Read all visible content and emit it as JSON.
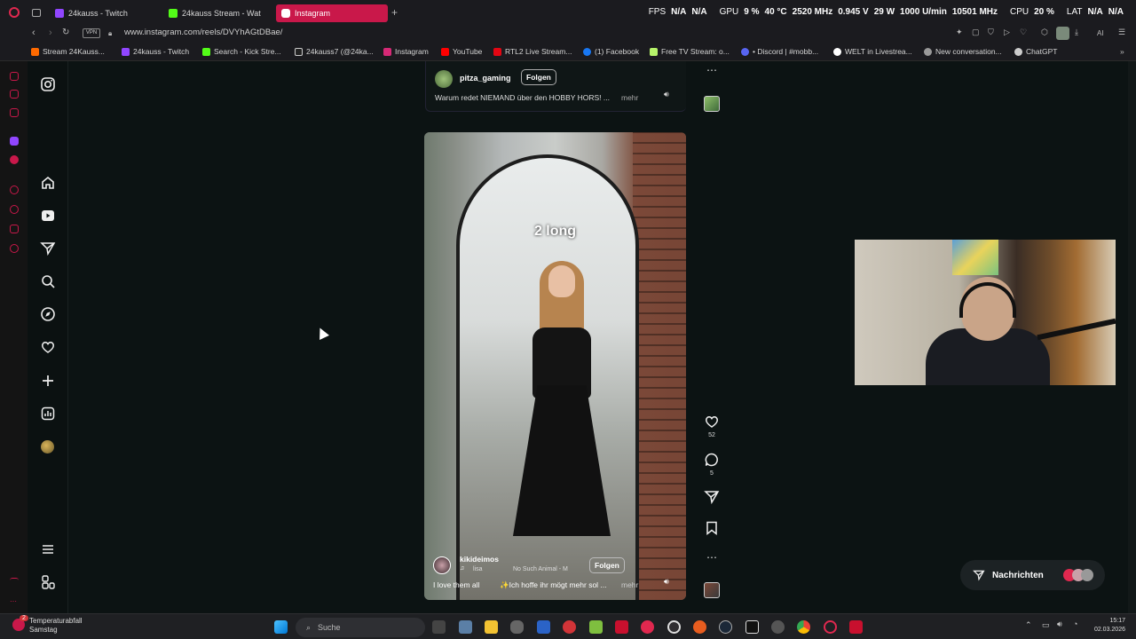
{
  "browser": {
    "tabs": [
      {
        "label": "24kauss - Twitch",
        "active": false
      },
      {
        "label": "24kauss Stream - Wat",
        "active": false
      },
      {
        "label": "Instagram",
        "active": true
      }
    ],
    "stats": {
      "fps_label": "FPS",
      "fps_value": "N/A",
      "fps_value2": "N/A",
      "gpu_label": "GPU",
      "gpu_load": "9 %",
      "gpu_temp": "40 °C",
      "gpu_clock": "2520 MHz",
      "gpu_voltage": "0.945 V",
      "gpu_power": "29 W",
      "gpu_fan": "1000 U/min",
      "gpu_mem": "10501 MHz",
      "cpu_label": "CPU",
      "cpu_load": "20 %",
      "lat_label": "LAT",
      "lat_value": "N/A",
      "lat_value2": "N/A"
    },
    "url": "www.instagram.com/reels/DVYhAGtDBae/",
    "vpn_label": "VPN",
    "ai_label": "AI",
    "bookmarks": [
      "Stream 24Kauss...",
      "24kauss - Twitch",
      "Search - Kick Stre...",
      "24kauss7 (@24ka...",
      "Instagram",
      "YouTube",
      "RTL2 Live Stream...",
      "(1) Facebook",
      "Free TV Stream: o...",
      "• Discord | #mobb...",
      "WELT in Livestrea...",
      "New conversation...",
      "ChatGPT"
    ]
  },
  "prev_post": {
    "username": "pitza_gaming",
    "follow_label": "Folgen",
    "caption": "Warum redet NIEMAND über den HOBBY HORS! ...",
    "more_label": "mehr"
  },
  "reel": {
    "overlay_text": "2 long",
    "username": "kikideimos",
    "follow_label": "Folgen",
    "audio_user": "lisa",
    "audio_track": "No Such Animal - M",
    "caption": "I love them all",
    "caption2": "✨Ich hoffe ihr mögt mehr sol ...",
    "more_label": "mehr",
    "likes": "52",
    "comments": "5"
  },
  "messages": {
    "label": "Nachrichten"
  },
  "taskbar": {
    "notification_count": "2",
    "weather_title": "Temperaturabfall",
    "weather_sub": "Samstag",
    "search_placeholder": "Suche",
    "time": "15:17",
    "date": "02.03.2026"
  },
  "colors": {
    "accent": "#c9184a",
    "background": "#0c1313"
  }
}
